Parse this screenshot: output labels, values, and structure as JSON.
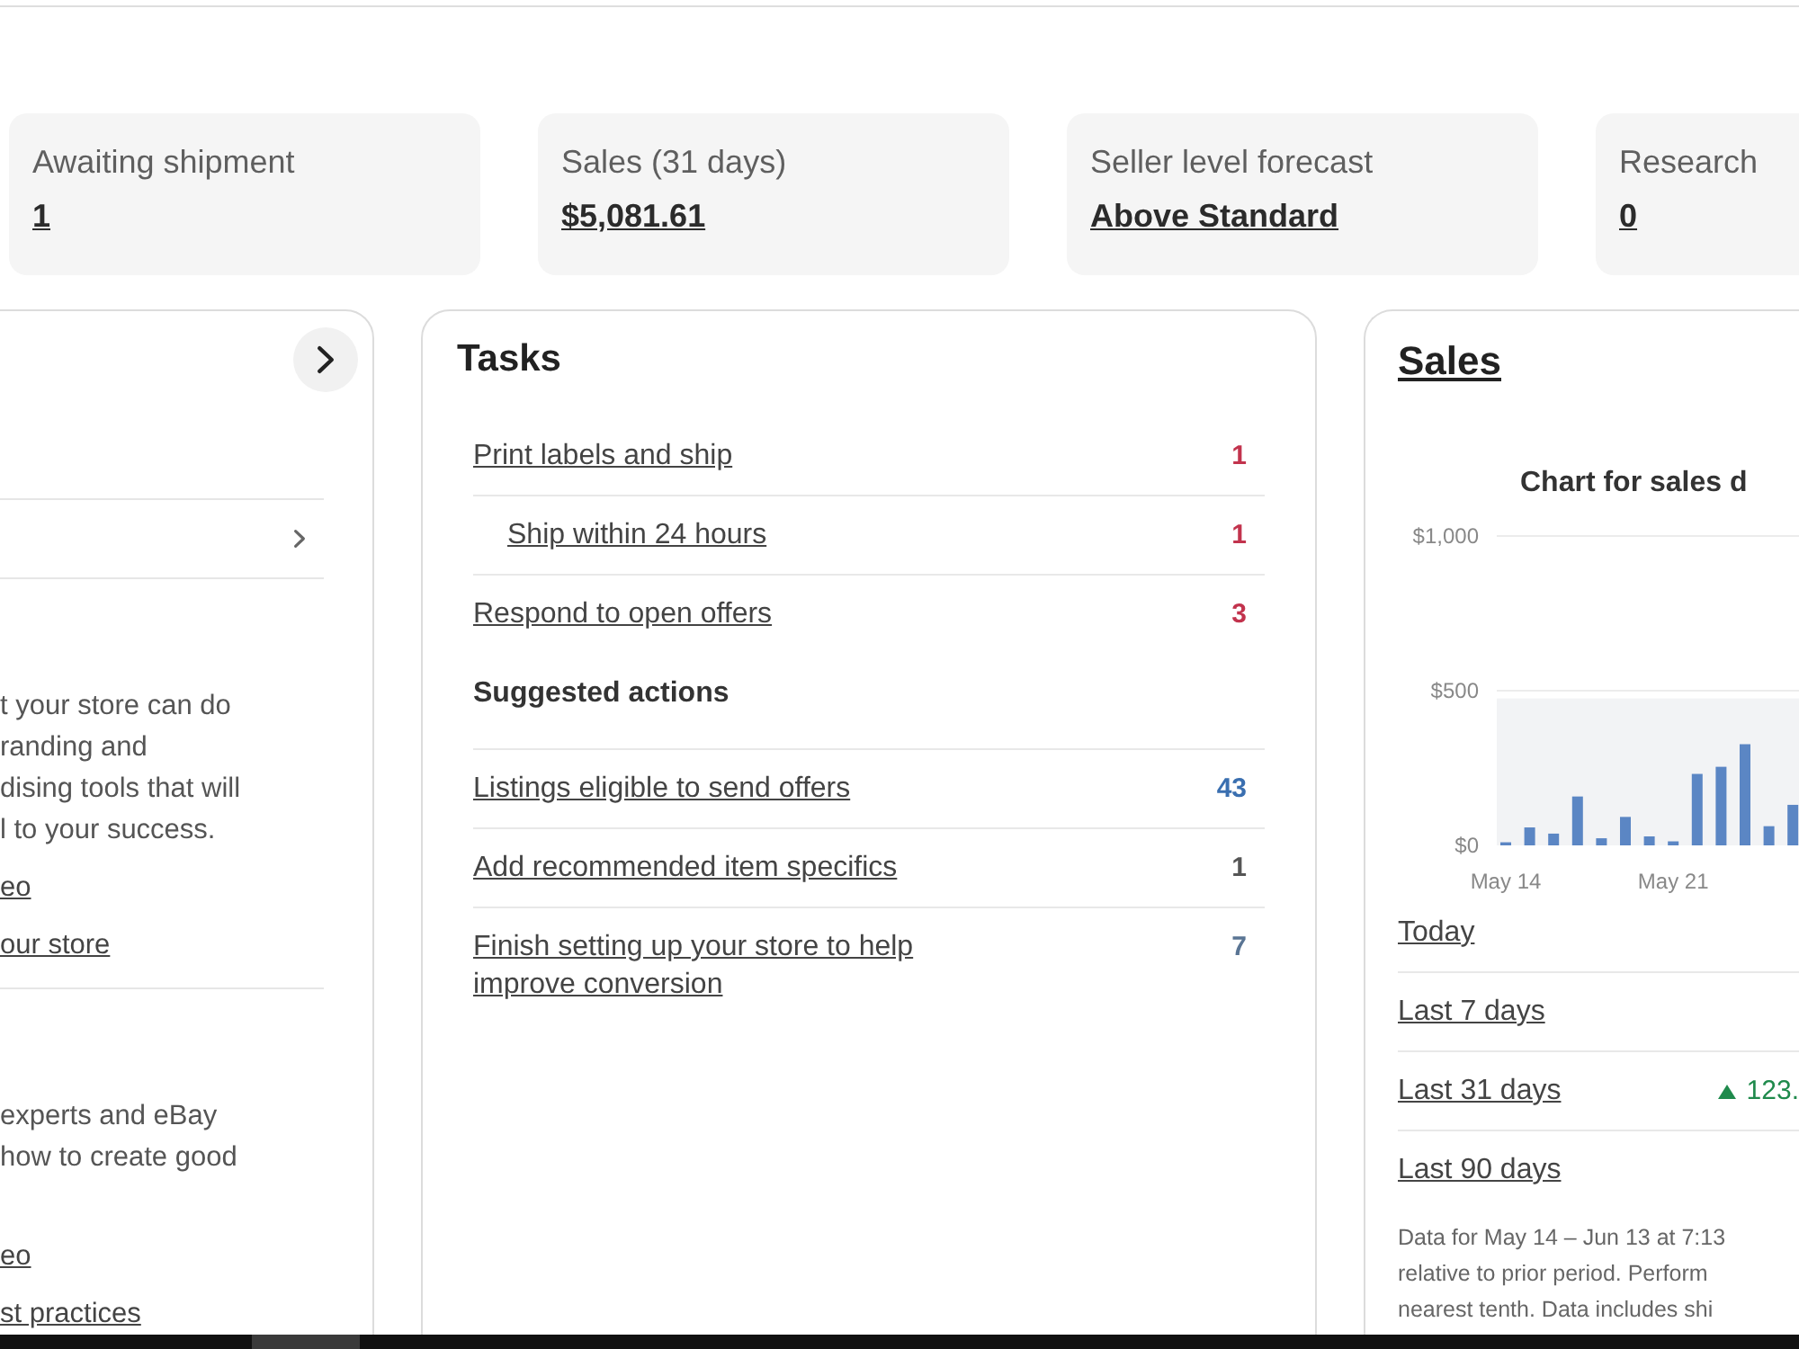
{
  "stat_cards": [
    {
      "label": "Awaiting shipment",
      "value": "1"
    },
    {
      "label": "Sales (31 days)",
      "value": "$5,081.61"
    },
    {
      "label": "Seller level forecast",
      "value": "Above Standard"
    },
    {
      "label": "Research",
      "value": "0"
    }
  ],
  "store_panel": {
    "sections": [
      {
        "text_lines": [
          "t your store can do",
          "randing and",
          "dising tools that will",
          "l to your success."
        ],
        "links": [
          "eo",
          "our store"
        ]
      },
      {
        "text_lines": [
          "experts and eBay",
          "how to create good"
        ],
        "links": [
          "eo",
          "st practices"
        ]
      }
    ]
  },
  "tasks": {
    "title": "Tasks",
    "items": [
      {
        "label": "Print labels and ship",
        "count": "1",
        "color": "#c2334d",
        "children": [
          {
            "label": "Ship within 24 hours",
            "count": "1",
            "color": "#c2334d"
          }
        ]
      },
      {
        "label": "Respond to open offers",
        "count": "3",
        "color": "#c2334d"
      }
    ],
    "suggested": {
      "heading": "Suggested actions",
      "items": [
        {
          "label": "Listings eligible to send offers",
          "count": "43",
          "color": "#3a6fb0"
        },
        {
          "label": "Add recommended item specifics",
          "count": "1",
          "color": "#555555"
        },
        {
          "label": "Finish setting up your store to help improve conversion",
          "count": "7",
          "color": "#5a7594"
        }
      ]
    }
  },
  "sales": {
    "title": "Sales",
    "chart_data": {
      "type": "bar",
      "title": "Chart for sales d",
      "categories": [
        "May 14",
        null,
        null,
        null,
        null,
        null,
        null,
        "May 21",
        null,
        null,
        null,
        null,
        null
      ],
      "values": [
        10,
        58,
        38,
        158,
        23,
        92,
        29,
        13,
        231,
        254,
        327,
        62,
        131
      ],
      "ylim": [
        0,
        1000
      ],
      "yticks": [
        {
          "value": 0,
          "label": "$0"
        },
        {
          "value": 500,
          "label": "$500"
        },
        {
          "value": 1000,
          "label": "$1,000"
        }
      ]
    },
    "periods": [
      {
        "label": "Today"
      },
      {
        "label": "Last 7 days"
      },
      {
        "label": "Last 31 days",
        "rising": true,
        "change": "123."
      },
      {
        "label": "Last 90 days"
      }
    ],
    "footnote_lines": [
      "Data for May 14 – Jun 13 at 7:13",
      "relative to prior period. Perform",
      "nearest tenth. Data includes shi"
    ]
  }
}
